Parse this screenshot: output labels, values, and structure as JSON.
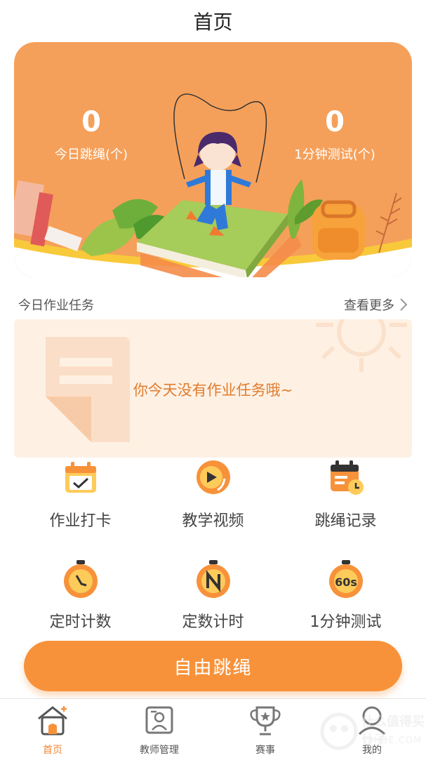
{
  "header": {
    "title": "首页"
  },
  "banner": {
    "left_stat": {
      "value": "0",
      "label": "今日跳绳(个)"
    },
    "right_stat": {
      "value": "0",
      "label": "1分钟测试(个)"
    }
  },
  "homework": {
    "title": "今日作业任务",
    "more_label": "查看更多",
    "empty_message": "你今天没有作业任务哦~"
  },
  "features": [
    {
      "label": "作业打卡",
      "icon": "calendar-check-icon"
    },
    {
      "label": "教学视频",
      "icon": "video-play-icon"
    },
    {
      "label": "跳绳记录",
      "icon": "record-calendar-icon"
    },
    {
      "label": "定时计数",
      "icon": "timer-icon"
    },
    {
      "label": "定数计时",
      "icon": "count-n-icon"
    },
    {
      "label": "1分钟测试",
      "icon": "60s-timer-icon"
    }
  ],
  "primary_button": {
    "label": "自由跳绳"
  },
  "tabbar": {
    "items": [
      {
        "label": "首页",
        "icon": "home-icon",
        "active": true
      },
      {
        "label": "教师管理",
        "icon": "teacher-icon",
        "active": false
      },
      {
        "label": "赛事",
        "icon": "trophy-icon",
        "active": false
      },
      {
        "label": "我的",
        "icon": "profile-icon",
        "active": false
      }
    ]
  },
  "watermark": {
    "text": "什么值得买 什子",
    "sub": "ZHIDE.COM"
  },
  "colors": {
    "accent": "#F7923A",
    "banner": "#F5A05A",
    "card_bg": "#FEF1E4",
    "active_tab": "#F0883A"
  }
}
